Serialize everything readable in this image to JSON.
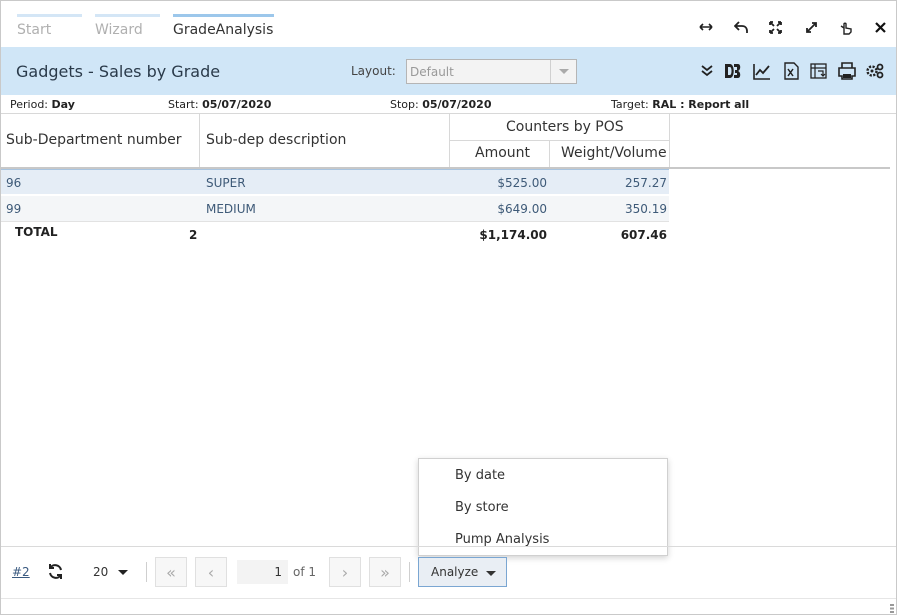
{
  "tabs": [
    {
      "label": "Start"
    },
    {
      "label": "Wizard"
    },
    {
      "label": "GradeAnalysis"
    }
  ],
  "window_controls": [
    "resize-horizontal-icon",
    "undo-icon",
    "fit-icon",
    "expand-icon",
    "pointer-icon",
    "close-icon"
  ],
  "header": {
    "title": "Gadgets - Sales by Grade",
    "layout_label": "Layout:",
    "layout_value": "Default",
    "tools": [
      "collapse-icon",
      "d3-icon",
      "line-chart-icon",
      "excel-export-icon",
      "pivot-icon",
      "print-icon",
      "settings-icon"
    ]
  },
  "info": {
    "period_label": "Period:",
    "period_value": "Day",
    "start_label": "Start:",
    "start_value": "05/07/2020",
    "stop_label": "Stop:",
    "stop_value": "05/07/2020",
    "target_label": "Target:",
    "target_value": "RAL : Report all"
  },
  "table": {
    "col_subdept": "Sub-Department number",
    "col_desc": "Sub-dep description",
    "group_header": "Counters by POS",
    "col_amount": "Amount",
    "col_weight": "Weight/Volume",
    "rows": [
      {
        "number": "96",
        "desc": "SUPER",
        "amount": "$525.00",
        "weight": "257.27"
      },
      {
        "number": "99",
        "desc": "MEDIUM",
        "amount": "$649.00",
        "weight": "350.19"
      }
    ],
    "total": {
      "label": "TOTAL",
      "count": "2",
      "amount": "$1,174.00",
      "weight": "607.46"
    }
  },
  "analyze_menu": {
    "items": [
      "By date",
      "By store",
      "Pump Analysis"
    ]
  },
  "footer": {
    "link": "#2",
    "page_size": "20",
    "page_value": "1",
    "of_label": "of 1",
    "analyze_label": "Analyze"
  }
}
